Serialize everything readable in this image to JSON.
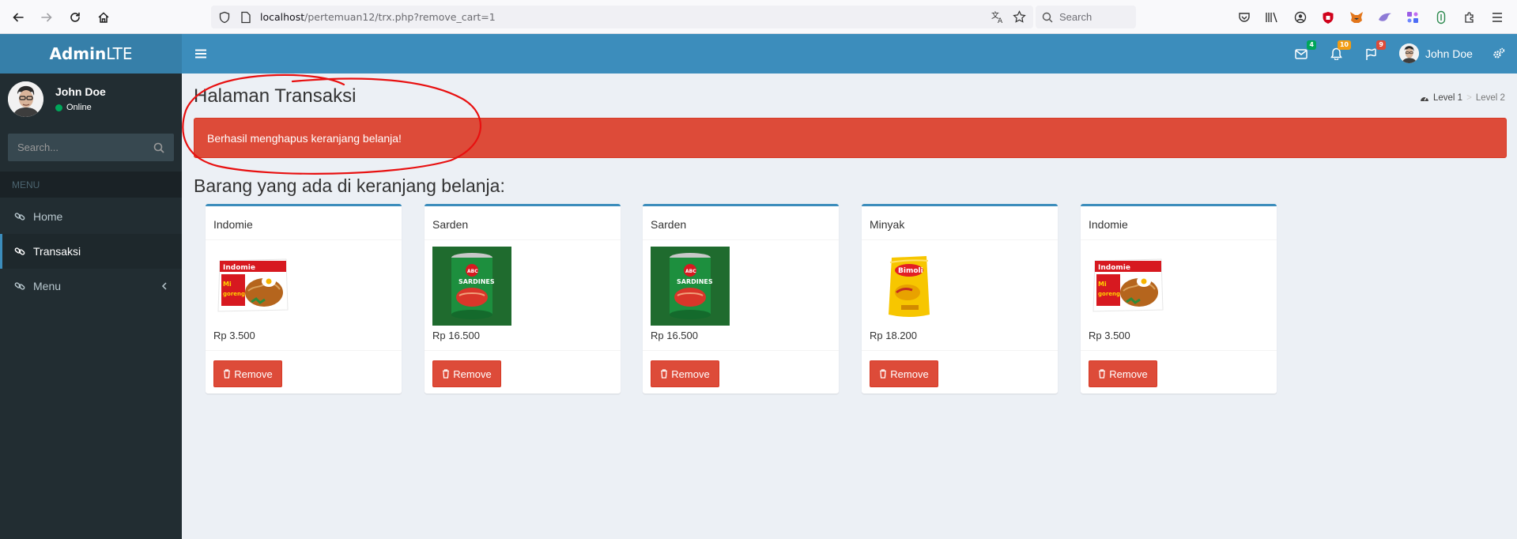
{
  "browser": {
    "url_host": "localhost",
    "url_path": "/pertemuan12/trx.php?remove_cart=1",
    "search_placeholder": "Search"
  },
  "colors": {
    "header": "#3c8dbc",
    "logo_bg": "#367fa9",
    "sidebar": "#222d32",
    "alert": "#dd4b39",
    "content_bg": "#ecf0f5",
    "annotation": "#e81010"
  },
  "logo": {
    "bold": "Admin",
    "light": "LTE"
  },
  "sidebar": {
    "user_name": "John Doe",
    "status": "Online",
    "search_placeholder": "Search...",
    "menu_header": "MENU",
    "items": [
      {
        "label": "Home",
        "icon": "link-icon"
      },
      {
        "label": "Transaksi",
        "icon": "link-icon",
        "active": true
      },
      {
        "label": "Menu",
        "icon": "link-icon",
        "has_submenu": true
      }
    ]
  },
  "header": {
    "badges": {
      "messages": "4",
      "notifications": "10",
      "tasks": "9"
    },
    "badge_colors": {
      "messages": "#00a65a",
      "notifications": "#f39c12",
      "tasks": "#dd4b39"
    },
    "user_name": "John Doe"
  },
  "content": {
    "title": "Halaman Transaksi",
    "breadcrumb": [
      "Level 1",
      "Level 2"
    ],
    "alert": "Berhasil menghapus keranjang belanja!",
    "section_title": "Barang yang ada di keranjang belanja:",
    "remove_label": "Remove",
    "items": [
      {
        "name": "Indomie",
        "price": "Rp 3.500",
        "image": "indomie-package"
      },
      {
        "name": "Sarden",
        "price": "Rp 16.500",
        "image": "sardines-can"
      },
      {
        "name": "Sarden",
        "price": "Rp 16.500",
        "image": "sardines-can"
      },
      {
        "name": "Minyak",
        "price": "Rp 18.200",
        "image": "oil-pouch"
      },
      {
        "name": "Indomie",
        "price": "Rp 3.500",
        "image": "indomie-package"
      }
    ]
  }
}
